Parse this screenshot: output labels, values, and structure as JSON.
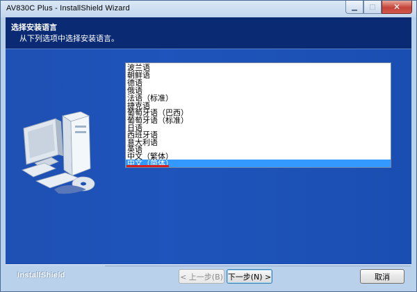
{
  "window": {
    "title": "AV830C Plus - InstallShield Wizard",
    "controls": {
      "minimize": "▁",
      "maximize": "□",
      "close": "✕"
    }
  },
  "header": {
    "title": "选择安装语言",
    "subtitle": "从下列选项中选择安装语言。"
  },
  "languages": {
    "items": [
      "波兰语",
      "朝鲜语",
      "德语",
      "俄语",
      "法语（标准）",
      "捷克语",
      "葡萄牙语（巴西）",
      "葡萄牙语（标准）",
      "日语",
      "西班牙语",
      "意大利语",
      "英语",
      "中文（繁体）",
      "中文（简体）"
    ],
    "selected": "中文（简体）"
  },
  "footer": {
    "brand": "InstallShield",
    "back_label": "< 上一步(B)",
    "next_label": "下一步(N) >",
    "cancel_label": "取消"
  },
  "colors": {
    "header_bg": "#0a2a74",
    "panel_bg": "#1f50b3",
    "selection": "#3399ff",
    "underline": "#d31f1f"
  }
}
